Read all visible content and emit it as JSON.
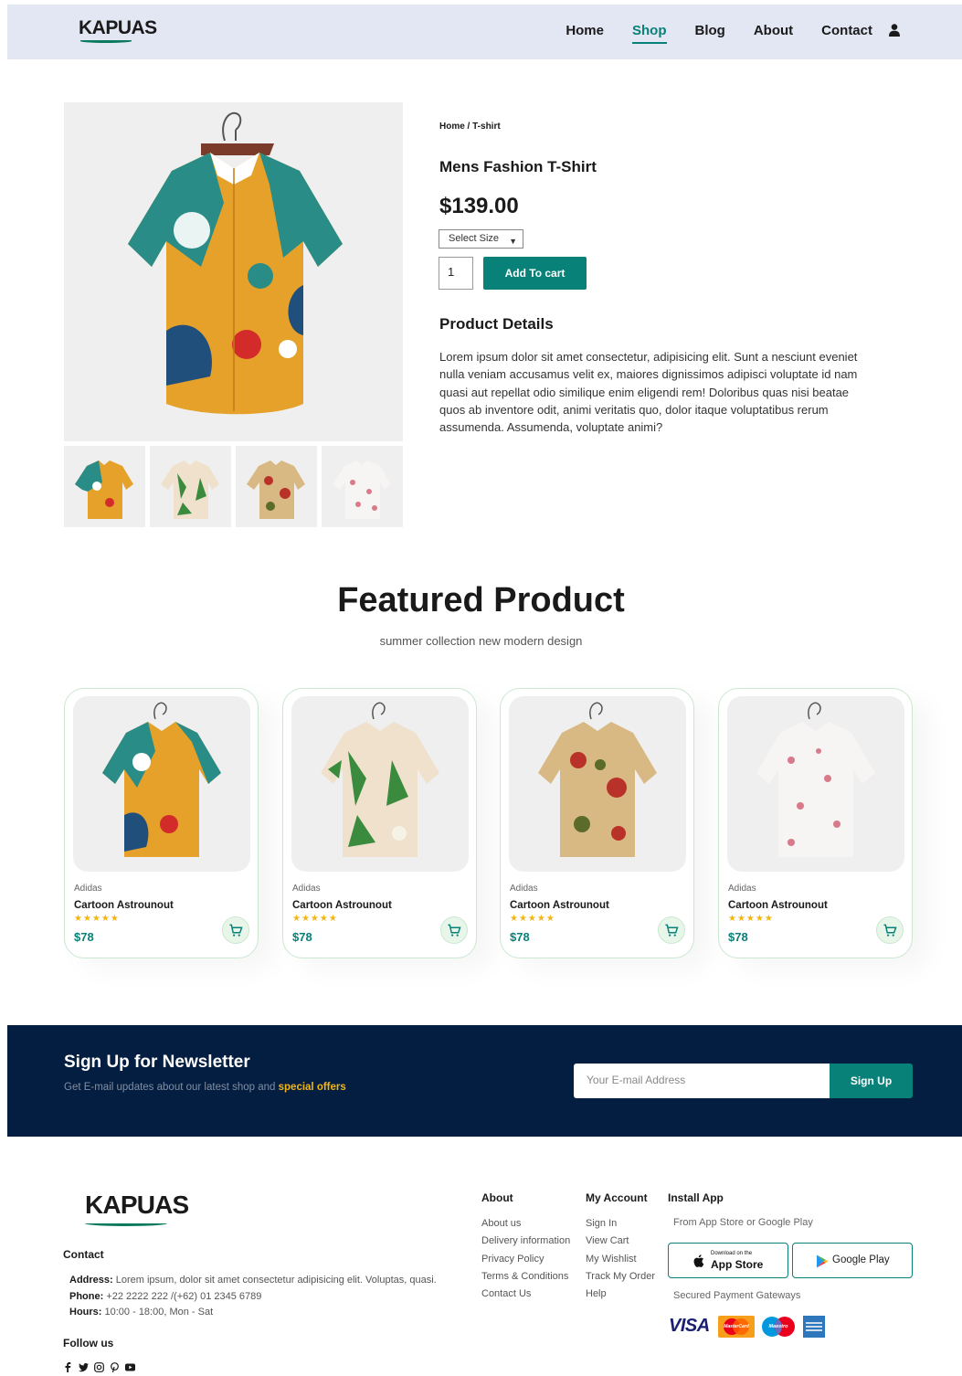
{
  "header": {
    "logo": "KAPUAS",
    "nav": [
      "Home",
      "Shop",
      "Blog",
      "About",
      "Contact"
    ],
    "active_nav": "Shop"
  },
  "product": {
    "breadcrumb": "Home / T-shirt",
    "title": "Mens Fashion T-Shirt",
    "price": "$139.00",
    "size_select": "Select Size",
    "quantity": "1",
    "add_to_cart": "Add To cart",
    "details_heading": "Product Details",
    "description": "Lorem ipsum dolor sit amet consectetur, adipisicing elit. Sunt a nesciunt eveniet nulla veniam accusamus velit ex, maiores dignissimos adipisci voluptate id nam quasi aut repellat odio similique enim eligendi rem! Doloribus quas nisi beatae quos ab inventore odit, animi veritatis quo, dolor itaque voluptatibus rerum assumenda. Assumenda, voluptate animi?"
  },
  "featured": {
    "heading": "Featured Product",
    "subheading": "summer collection new modern design",
    "cards": [
      {
        "brand": "Adidas",
        "name": "Cartoon Astrounout",
        "stars": "★★★★★",
        "price": "$78"
      },
      {
        "brand": "Adidas",
        "name": "Cartoon Astrounout",
        "stars": "★★★★★",
        "price": "$78"
      },
      {
        "brand": "Adidas",
        "name": "Cartoon Astrounout",
        "stars": "★★★★★",
        "price": "$78"
      },
      {
        "brand": "Adidas",
        "name": "Cartoon Astrounout",
        "stars": "★★★★★",
        "price": "$78"
      }
    ]
  },
  "newsletter": {
    "heading": "Sign Up for Newsletter",
    "text": "Get E-mail updates about our latest shop and",
    "highlight": "special offers",
    "placeholder": "Your E-mail Address",
    "button": "Sign Up"
  },
  "footer": {
    "logo": "KAPUAS",
    "contact_heading": "Contact",
    "address_label": "Address:",
    "address": "Lorem ipsum, dolor sit amet consectetur adipisicing elit. Voluptas, quasi.",
    "phone_label": "Phone:",
    "phone": "+22 2222 222 /(+62) 01 2345 6789",
    "hours_label": "Hours:",
    "hours": "10:00 - 18:00, Mon - Sat",
    "follow_heading": "Follow us",
    "about_heading": "About",
    "about_links": [
      "About us",
      "Delivery information",
      "Privacy Policy",
      "Terms & Conditions",
      "Contact Us"
    ],
    "account_heading": "My Account",
    "account_links": [
      "Sign In",
      "View Cart",
      "My Wishlist",
      "Track My Order",
      "Help"
    ],
    "install_heading": "Install App",
    "install_note": "From App Store or Google Play",
    "appstore_small": "Download on the",
    "appstore_big": "App Store",
    "googleplay": "Google Play",
    "payment_note": "Secured Payment Gateways",
    "payment_visa": "VISA",
    "payment_mastercard": "MasterCard",
    "payment_maestro": "Maestro"
  },
  "colors": {
    "brand": "#088178",
    "header_bg": "#e3e6f3",
    "newsletter_bg": "#041e42",
    "star": "#f3b513"
  }
}
